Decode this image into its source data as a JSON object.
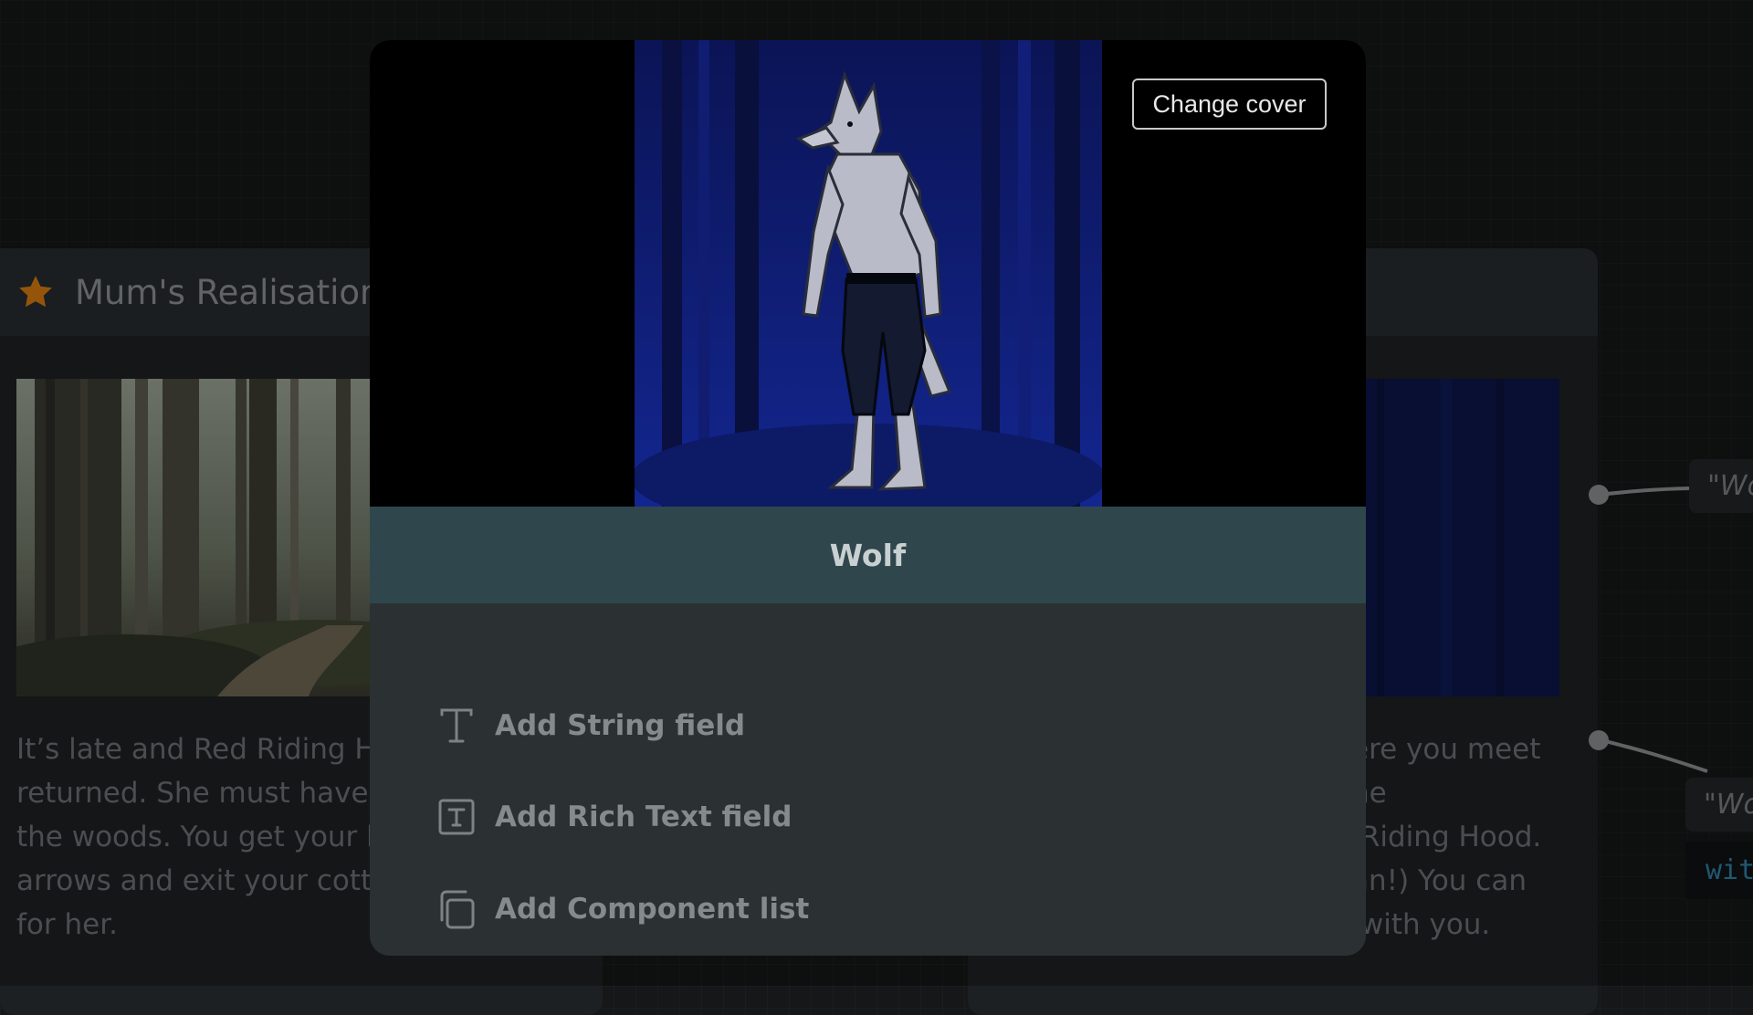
{
  "background": {
    "left_card": {
      "title": "Mum's Realisation",
      "star_icon": "star-icon",
      "text_lines": [
        "It’s late and Red Riding Ho",
        "returned. She must have w",
        "the woods. You get your b",
        "arrows and exit your cotta",
        "for her."
      ]
    },
    "right_card": {
      "text_lines": [
        "ere you meet",
        "he",
        " Riding Hood.",
        "an!) You can",
        " with you."
      ]
    },
    "node_box_1": "\"Wo",
    "node_box_2": "\"Wo",
    "code_box": "wit"
  },
  "modal": {
    "change_cover_label": "Change cover",
    "title": "Wolf",
    "fields": [
      {
        "label": "Add String field",
        "icon": "text-t-icon"
      },
      {
        "label": "Add Rich Text field",
        "icon": "rich-text-icon"
      },
      {
        "label": "Add Component list",
        "icon": "component-list-icon"
      }
    ]
  },
  "colors": {
    "star": "#d47a10",
    "name_bar": "#2f474c",
    "modal_body": "#2b3032"
  }
}
